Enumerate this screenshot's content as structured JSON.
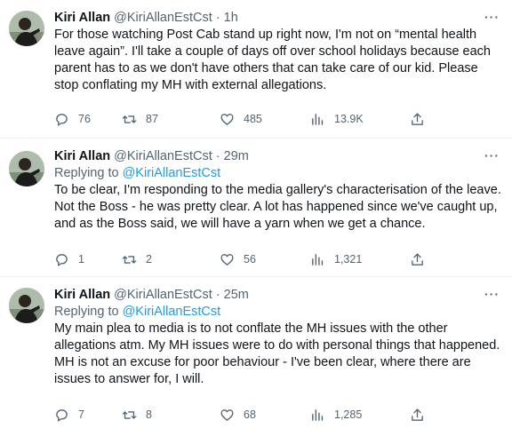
{
  "tweets": [
    {
      "name": "Kiri Allan",
      "handle": "@KiriAllanEstCst",
      "dot": "·",
      "time": "1h",
      "replying_prefix": "",
      "replying_to": "",
      "text": "For those watching Post Cab stand up right now, I'm not on “mental health leave again”. I'll take a couple of days off over school holidays because each parent has to as we don't have others that can take care of our kid. Please stop conflating my MH with external allegations.",
      "stats": {
        "replies": "76",
        "retweets": "87",
        "likes": "485",
        "views": "13.9K"
      }
    },
    {
      "name": "Kiri Allan",
      "handle": "@KiriAllanEstCst",
      "dot": "·",
      "time": "29m",
      "replying_prefix": "Replying to ",
      "replying_to": "@KiriAllanEstCst",
      "text": "To be clear, I'm responding to the media gallery's characterisation of the leave. Not the Boss - he was pretty clear. A lot has happened since we've caught up, and as the Boss said, we will have a yarn when we get a chance.",
      "stats": {
        "replies": "1",
        "retweets": "2",
        "likes": "56",
        "views": "1,321"
      }
    },
    {
      "name": "Kiri Allan",
      "handle": "@KiriAllanEstCst",
      "dot": "·",
      "time": "25m",
      "replying_prefix": "Replying to ",
      "replying_to": "@KiriAllanEstCst",
      "text": "My main plea to media is to not conflate the MH issues with the other allegations atm. My MH issues were to do with personal things that happened. MH is not an excuse for poor behaviour - I've been clear, where there are issues to answer for, I will.",
      "stats": {
        "replies": "7",
        "retweets": "8",
        "likes": "68",
        "views": "1,285"
      }
    }
  ],
  "more_glyph": "···",
  "icons": {
    "reply": "reply-icon",
    "retweet": "retweet-icon",
    "like": "heart-icon",
    "views": "views-icon",
    "share": "share-icon",
    "more": "more-icon"
  },
  "colors": {
    "text": "#0f1419",
    "muted": "#536471",
    "mention": "#1d9bf0",
    "divider": "#eff3f4"
  }
}
